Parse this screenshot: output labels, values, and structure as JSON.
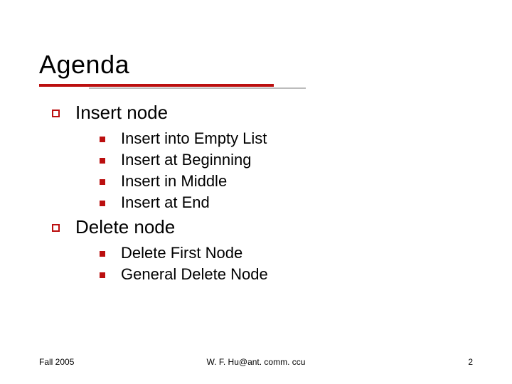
{
  "title": "Agenda",
  "sections": [
    {
      "label": "Insert node",
      "items": [
        "Insert into Empty List",
        "Insert at Beginning",
        "Insert in Middle",
        "Insert at End"
      ]
    },
    {
      "label": "Delete node",
      "items": [
        "Delete First Node",
        "General Delete Node"
      ]
    }
  ],
  "footer": {
    "left": "Fall 2005",
    "center": "W. F. Hu@ant. comm. ccu",
    "right": "2"
  }
}
